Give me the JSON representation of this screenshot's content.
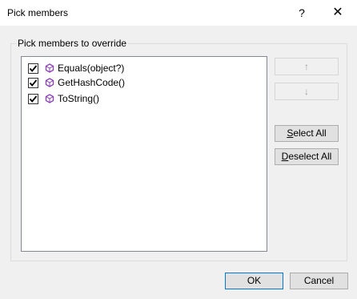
{
  "window": {
    "title": "Pick members",
    "help_symbol": "?",
    "close_symbol": "✕"
  },
  "group": {
    "label": "Pick members to override"
  },
  "members": [
    {
      "label": "Equals(object?)",
      "checked": true,
      "icon": "method-icon"
    },
    {
      "label": "GetHashCode()",
      "checked": true,
      "icon": "method-icon"
    },
    {
      "label": "ToString()",
      "checked": true,
      "icon": "method-icon"
    }
  ],
  "buttons": {
    "move_up_symbol": "↑",
    "move_down_symbol": "↓",
    "select_all_access": "S",
    "select_all_rest": "elect All",
    "deselect_all_access": "D",
    "deselect_all_rest": "eselect All",
    "ok": "OK",
    "cancel": "Cancel"
  },
  "colors": {
    "accent": "#0078d7",
    "method_icon": "#8a3fb8"
  }
}
